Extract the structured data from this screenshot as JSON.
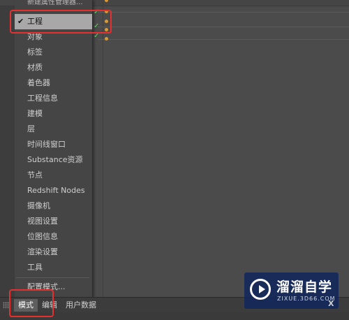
{
  "menu": {
    "top_cut_label": "新建属性管理器...",
    "items": [
      {
        "label": "工程",
        "checked": true
      },
      {
        "label": "对象"
      },
      {
        "label": "标签"
      },
      {
        "label": "材质"
      },
      {
        "label": "着色器"
      },
      {
        "label": "工程信息"
      },
      {
        "label": "建模"
      },
      {
        "label": "层"
      },
      {
        "label": "时间线窗口"
      },
      {
        "label": "Substance资源"
      },
      {
        "label": "节点"
      },
      {
        "label": "Redshift Nodes"
      },
      {
        "label": "摄像机"
      },
      {
        "label": "视图设置"
      },
      {
        "label": "位图信息"
      },
      {
        "label": "渲染设置"
      },
      {
        "label": "工具"
      }
    ],
    "configure_label": "配置模式..."
  },
  "check_glyph": "✔",
  "bottom_tabs": [
    "模式",
    "编辑",
    "用户数据"
  ],
  "status_text": "",
  "watermark": {
    "title": "溜溜自学",
    "subtitle": "ZIXUE.3D66.COM"
  },
  "corner_mark": "X",
  "colors": {
    "highlight": "#e53030",
    "selected_bg": "#a8a8a8",
    "check_green": "#6ad06a",
    "dot_orange": "#d79a3a"
  }
}
